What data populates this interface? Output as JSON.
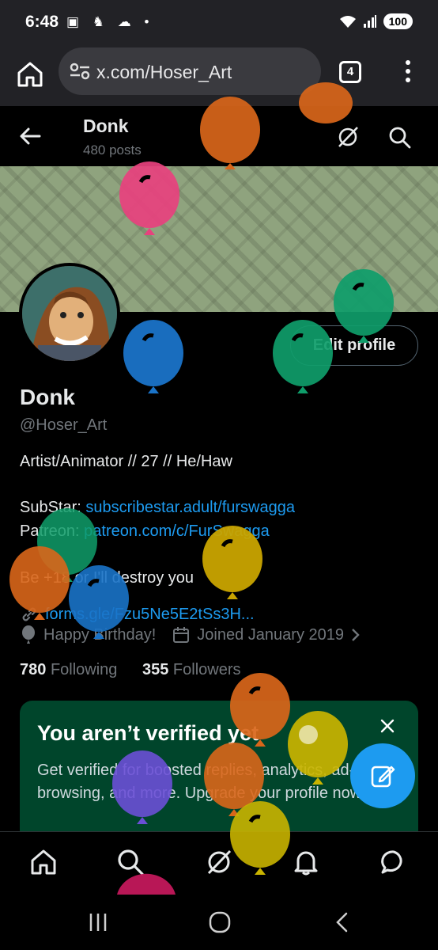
{
  "status_bar": {
    "time": "6:48",
    "battery": "100"
  },
  "browser": {
    "url": "x.com/Hoser_Art",
    "tab_count": "4"
  },
  "top_nav": {
    "name": "Donk",
    "posts": "480 posts"
  },
  "profile": {
    "edit_label": "Edit profile",
    "name": "Donk",
    "handle": "@Hoser_Art",
    "bio_line1": "Artist/Animator // 27 // He/Haw",
    "substar_label": "SubStar: ",
    "substar_link": "subscribestar.adult/furswagga",
    "patreon_label": "Patreon: ",
    "patreon_link": "patreon.com/c/FurSwagga",
    "bio_line4": "Be +18 or I'll destroy you",
    "link": "forms.gle/Fzu5Ne5E2tSs3H...",
    "birthday": "Happy Birthday!",
    "joined": "Joined January 2019",
    "following_count": "780",
    "following_label": "Following",
    "followers_count": "355",
    "followers_label": "Followers"
  },
  "verify_card": {
    "title": "You aren’t verified yet",
    "text": "Get verified for boosted replies, analytics, ad-free browsing, and more. Upgrade your profile now."
  },
  "colors": {
    "accent": "#1d9bf0",
    "muted": "#71767b",
    "card_bg": "#00452b",
    "banner": "#8fa37e"
  },
  "icons": {
    "bottom_nav": [
      "home-icon",
      "search-icon",
      "grok-icon",
      "bell-icon",
      "messages-icon"
    ],
    "system_nav": [
      "recents-icon",
      "home-circle-icon",
      "back-chevron-icon"
    ]
  }
}
